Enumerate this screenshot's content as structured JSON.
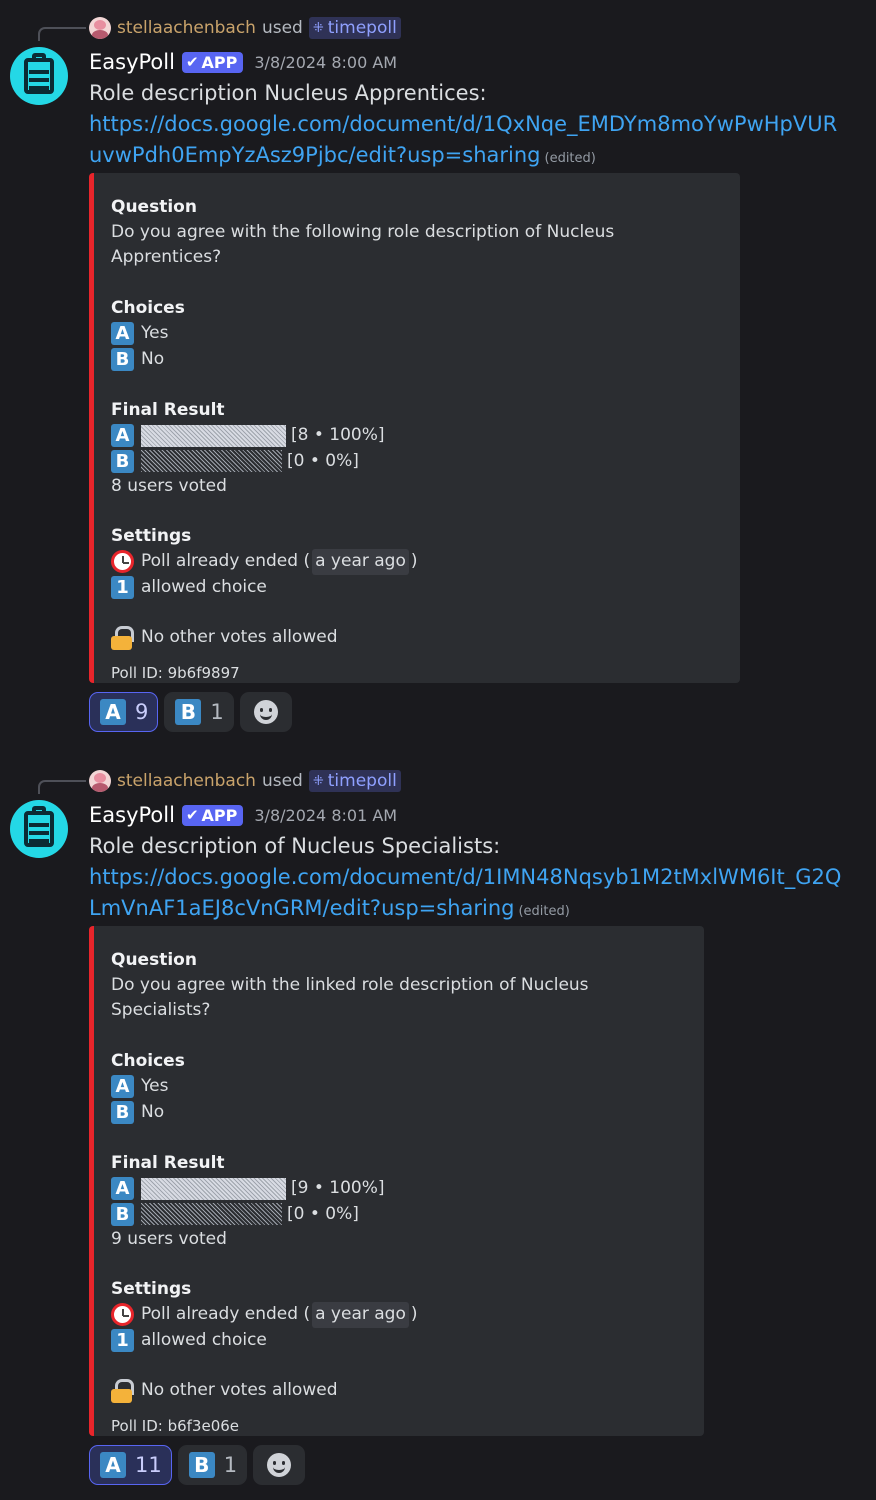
{
  "messages": [
    {
      "reply": {
        "user": "stellaachenbach",
        "used": "used",
        "command": "timepoll"
      },
      "author": "EasyPoll",
      "badge": "APP",
      "timestamp": "3/8/2024 8:00 AM",
      "title": "Role description Nucleus Apprentices:",
      "link": "https://docs.google.com/document/d/1QxNqe_EMDYm8moYwPwHpVURuvwPdh0EmpYzAsz9Pjbc/edit?usp=sharing",
      "edited": "(edited)",
      "embed": {
        "question_label": "Question",
        "question": "Do you agree with the following role description of Nucleus Apprentices?",
        "choices_label": "Choices",
        "choices": [
          {
            "key": "A",
            "text": "Yes"
          },
          {
            "key": "B",
            "text": "No"
          }
        ],
        "result_label": "Final Result",
        "results": [
          {
            "key": "A",
            "label": "[8 • 100%]",
            "share": 1.0
          },
          {
            "key": "B",
            "label": "[0 • 0%]",
            "share": 0.0
          }
        ],
        "voters": "8 users voted",
        "settings_label": "Settings",
        "ended_prefix": "Poll already ended (",
        "ended_time": "a year ago",
        "ended_suffix": ")",
        "allowed_key": "1",
        "allowed_text": "allowed choice",
        "lock_text": "No other votes allowed",
        "poll_id": "Poll ID: 9b6f9897"
      },
      "reactions": [
        {
          "key": "A",
          "count": "9",
          "me": true
        },
        {
          "key": "B",
          "count": "1",
          "me": false
        }
      ]
    },
    {
      "reply": {
        "user": "stellaachenbach",
        "used": "used",
        "command": "timepoll"
      },
      "author": "EasyPoll",
      "badge": "APP",
      "timestamp": "3/8/2024 8:01 AM",
      "title": "Role description of Nucleus Specialists:",
      "link": "https://docs.google.com/document/d/1IMN48Nqsyb1M2tMxlWM6It_G2QLmVnAF1aEJ8cVnGRM/edit?usp=sharing",
      "edited": "(edited)",
      "embed": {
        "question_label": "Question",
        "question": "Do you agree with the linked role description of Nucleus Specialists?",
        "choices_label": "Choices",
        "choices": [
          {
            "key": "A",
            "text": "Yes"
          },
          {
            "key": "B",
            "text": "No"
          }
        ],
        "result_label": "Final Result",
        "results": [
          {
            "key": "A",
            "label": "[9 • 100%]",
            "share": 1.0
          },
          {
            "key": "B",
            "label": "[0 • 0%]",
            "share": 0.0
          }
        ],
        "voters": "9 users voted",
        "settings_label": "Settings",
        "ended_prefix": "Poll already ended (",
        "ended_time": "a year ago",
        "ended_suffix": ")",
        "allowed_key": "1",
        "allowed_text": "allowed choice",
        "lock_text": "No other votes allowed",
        "poll_id": "Poll ID: b6f3e06e"
      },
      "reactions": [
        {
          "key": "A",
          "count": "11",
          "me": true
        },
        {
          "key": "B",
          "count": "1",
          "me": false
        }
      ]
    }
  ],
  "colors": {
    "embed_accent": "#e8252b",
    "link": "#3fa4f2",
    "app_badge": "#5865f2",
    "key_blue": "#3b88c3"
  },
  "icons": {
    "avatar": "clipboard-icon",
    "command": "slash-command-icon",
    "add_reaction": "smile-icon"
  }
}
